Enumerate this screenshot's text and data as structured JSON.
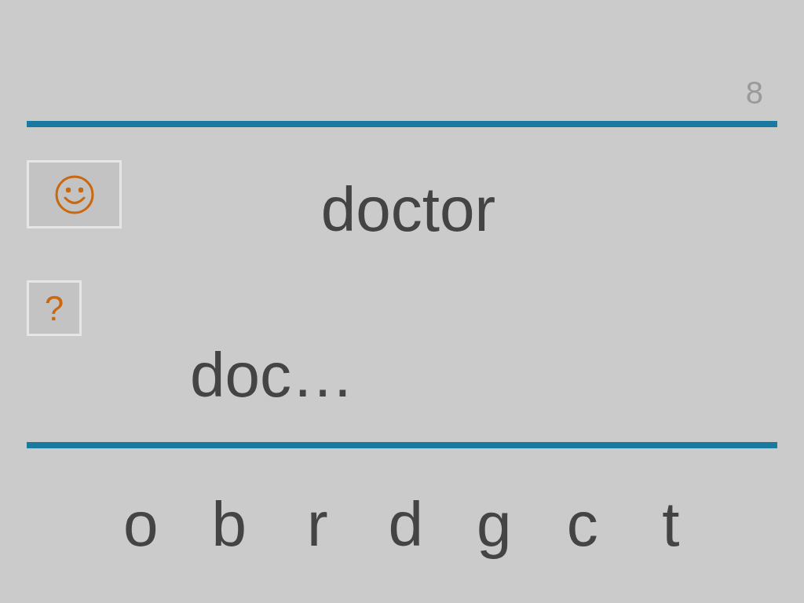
{
  "page_number": "8",
  "word": "doctor",
  "hint_button": {
    "label": "?"
  },
  "answer": "doc…",
  "letters": [
    "o",
    "b",
    "r",
    "d",
    "g",
    "c",
    "t"
  ]
}
